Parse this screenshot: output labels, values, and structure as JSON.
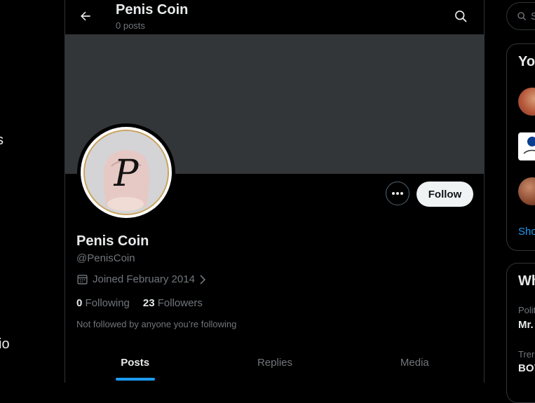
{
  "left_nav": {
    "fragment_1": "s",
    "fragment_2": "io"
  },
  "header": {
    "title": "Penis Coin",
    "post_count": "0 posts"
  },
  "profile": {
    "avatar_letter": "P",
    "display_name": "Penis Coin",
    "handle": "@PenisCoin",
    "joined": "Joined February 2014",
    "following_count": "0",
    "following_label": "Following",
    "followers_count": "23",
    "followers_label": "Followers",
    "not_followed_text": "Not followed by anyone you’re following",
    "follow_label": "Follow"
  },
  "tabs": [
    {
      "label": "Posts",
      "active": true
    },
    {
      "label": "Replies",
      "active": false
    },
    {
      "label": "Media",
      "active": false
    }
  ],
  "right": {
    "search_placeholder": "S",
    "who_to_follow_title": "Yo",
    "show_more": "Sho",
    "whats_happening_title": "Wh",
    "trends": [
      {
        "category": "Polit",
        "name": "Mr."
      },
      {
        "category": "Trer",
        "name": "BOY"
      }
    ]
  },
  "colors": {
    "accent": "#1d9bf0",
    "banner": "#333639",
    "avatar_ring": "#c9a25c"
  }
}
